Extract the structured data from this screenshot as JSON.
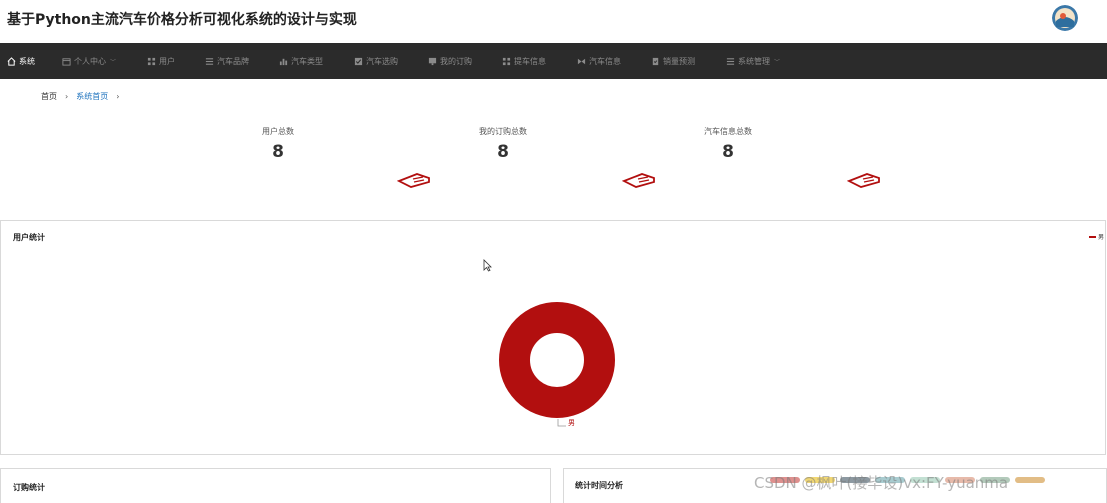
{
  "header": {
    "title": "基于Python主流汽车价格分析可视化系统的设计与实现"
  },
  "nav": {
    "items": [
      {
        "label": "系统",
        "icon": "home-icon"
      },
      {
        "label": "个人中心",
        "icon": "calendar-icon"
      },
      {
        "label": "用户",
        "icon": "grid-icon"
      },
      {
        "label": "汽车品牌",
        "icon": "list-icon"
      },
      {
        "label": "汽车类型",
        "icon": "bar-chart-icon"
      },
      {
        "label": "汽车选购",
        "icon": "checkbox-icon"
      },
      {
        "label": "我的订购",
        "icon": "monitor-icon"
      },
      {
        "label": "提车信息",
        "icon": "grid-icon"
      },
      {
        "label": "汽车信息",
        "icon": "bowtie-icon"
      },
      {
        "label": "销量预测",
        "icon": "clipboard-icon"
      },
      {
        "label": "系统管理",
        "icon": "list-icon"
      }
    ]
  },
  "breadcrumb": {
    "home": "首页",
    "current": "系统首页"
  },
  "stats": [
    {
      "label": "用户总数",
      "value": "8"
    },
    {
      "label": "我的订购总数",
      "value": "8"
    },
    {
      "label": "汽车信息总数",
      "value": "8"
    }
  ],
  "panels": {
    "user_stats": {
      "title": "用户统计",
      "legend": "男",
      "slice_label": "男"
    },
    "order_stats": {
      "title": "订购统计"
    },
    "time_analysis": {
      "title": "统计时间分析"
    }
  },
  "watermark": "CSDN @枫叶(接毕设)vx:FY-yuanma",
  "colors": {
    "navbar": "#2b2b2b",
    "accent": "#b20f0f",
    "link": "#1e73be"
  },
  "chart_data": {
    "type": "pie",
    "title": "用户统计",
    "categories": [
      "男"
    ],
    "values": [
      8
    ],
    "legend_position": "top-right",
    "donut": true
  }
}
